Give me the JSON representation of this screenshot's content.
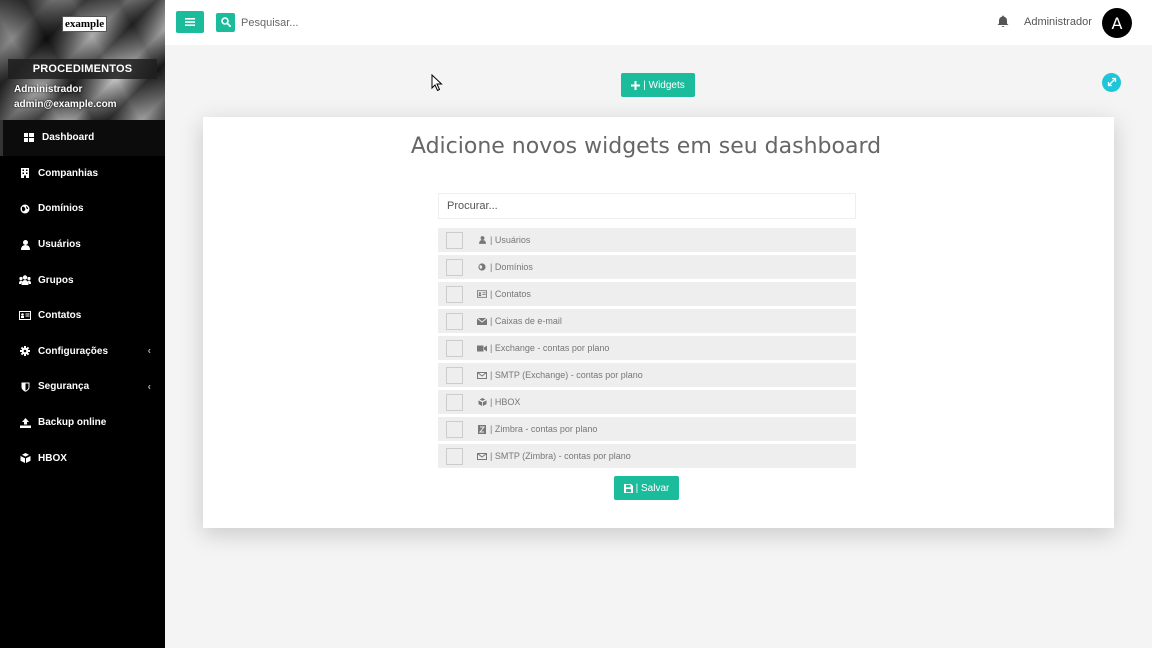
{
  "sidebar": {
    "logo": "example",
    "section_title": "PROCEDIMENTOS",
    "user_name": "Administrador",
    "user_email": "admin@example.com",
    "items": [
      {
        "label": "Dashboard",
        "icon": "dashboard-icon",
        "active": true
      },
      {
        "label": "Companhias",
        "icon": "building-icon"
      },
      {
        "label": "Domínios",
        "icon": "globe-icon"
      },
      {
        "label": "Usuários",
        "icon": "user-icon"
      },
      {
        "label": "Grupos",
        "icon": "users-icon"
      },
      {
        "label": "Contatos",
        "icon": "contact-card-icon"
      },
      {
        "label": "Configurações",
        "icon": "gear-icon",
        "chevron": "‹"
      },
      {
        "label": "Segurança",
        "icon": "shield-icon",
        "chevron": "‹"
      },
      {
        "label": "Backup online",
        "icon": "upload-icon"
      },
      {
        "label": "HBOX",
        "icon": "cubes-icon"
      }
    ]
  },
  "topbar": {
    "search_placeholder": "Pesquisar...",
    "user_label": "Administrador",
    "avatar_initial": "A"
  },
  "main": {
    "widgets_button": "| Widgets",
    "card": {
      "title": "Adicione novos widgets em seu dashboard",
      "search_placeholder": "Procurar...",
      "widgets": [
        {
          "label": "| Usuários",
          "icon": "user-icon"
        },
        {
          "label": "| Domínios",
          "icon": "globe-icon"
        },
        {
          "label": "| Contatos",
          "icon": "contact-card-icon"
        },
        {
          "label": "| Caixas de e-mail",
          "icon": "envelope-icon"
        },
        {
          "label": "| Exchange - contas por plano",
          "icon": "video-icon"
        },
        {
          "label": "| SMTP (Exchange) - contas por plano",
          "icon": "envelope-outline-icon"
        },
        {
          "label": "| HBOX",
          "icon": "cubes-icon"
        },
        {
          "label": "| Zimbra - contas por plano",
          "icon": "zimbra-icon"
        },
        {
          "label": "| SMTP (Zimbra) - contas por plano",
          "icon": "envelope-outline-icon"
        }
      ],
      "save_button": "| Salvar"
    }
  },
  "colors": {
    "accent": "#1abc9c",
    "expand": "#1fc6d8",
    "sidebar_bg": "#000000"
  }
}
